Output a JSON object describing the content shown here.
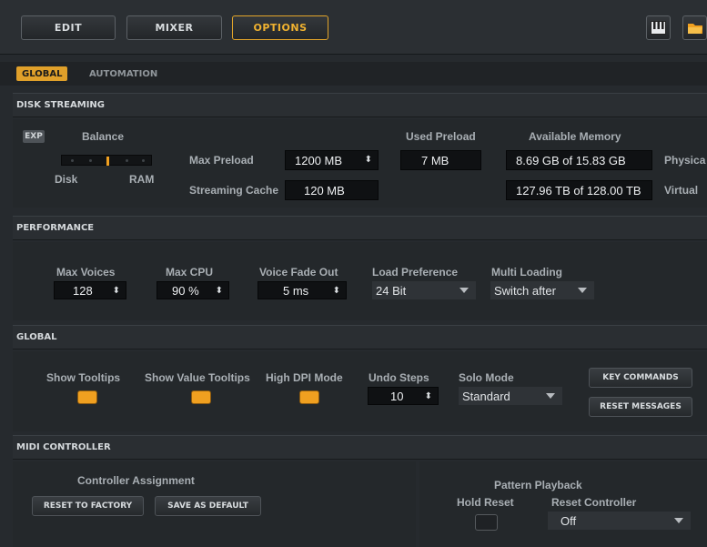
{
  "toolbar": {
    "edit": "EDIT",
    "mixer": "MIXER",
    "options": "OPTIONS",
    "icons": [
      "keyboard-icon",
      "folder-icon"
    ],
    "accent": "#f0b230"
  },
  "tabs": {
    "global": "GLOBAL",
    "automation": "AUTOMATION"
  },
  "disk": {
    "title": "DISK STREAMING",
    "exp": "EXP",
    "balance_label": "Balance",
    "balance_level": 0.5,
    "disk_label": "Disk",
    "ram_label": "RAM",
    "max_preload_label": "Max Preload",
    "max_preload_value": "1200 MB",
    "streaming_cache_label": "Streaming Cache",
    "streaming_cache_value": "120 MB",
    "used_preload_label": "Used Preload",
    "used_preload_value": "7 MB",
    "available_memory_label": "Available Memory",
    "physical_value": "8.69 GB of 15.83 GB",
    "physical_label": "Physica",
    "virtual_value": "127.96 TB of 128.00 TB",
    "virtual_label": "Virtual"
  },
  "performance": {
    "title": "PERFORMANCE",
    "max_voices_label": "Max Voices",
    "max_voices_value": "128",
    "max_cpu_label": "Max CPU",
    "max_cpu_value": "90 %",
    "voice_fade_label": "Voice Fade Out",
    "voice_fade_value": "5 ms",
    "load_pref_label": "Load Preference",
    "load_pref_value": "24 Bit",
    "multi_loading_label": "Multi Loading",
    "multi_loading_value": "Switch after"
  },
  "global": {
    "title": "GLOBAL",
    "show_tooltips_label": "Show Tooltips",
    "show_value_tooltips_label": "Show Value Tooltips",
    "high_dpi_label": "High DPI Mode",
    "undo_steps_label": "Undo Steps",
    "undo_steps_value": "10",
    "solo_mode_label": "Solo Mode",
    "solo_mode_value": "Standard",
    "key_commands": "KEY COMMANDS",
    "reset_messages": "RESET MESSAGES"
  },
  "midi": {
    "title": "MIDI CONTROLLER",
    "controller_assignment_label": "Controller Assignment",
    "reset_to_factory": "RESET TO FACTORY",
    "save_as_default": "SAVE AS DEFAULT",
    "pattern_playback_label": "Pattern Playback",
    "hold_reset_label": "Hold Reset",
    "reset_controller_label": "Reset Controller",
    "reset_controller_value": "Off"
  }
}
